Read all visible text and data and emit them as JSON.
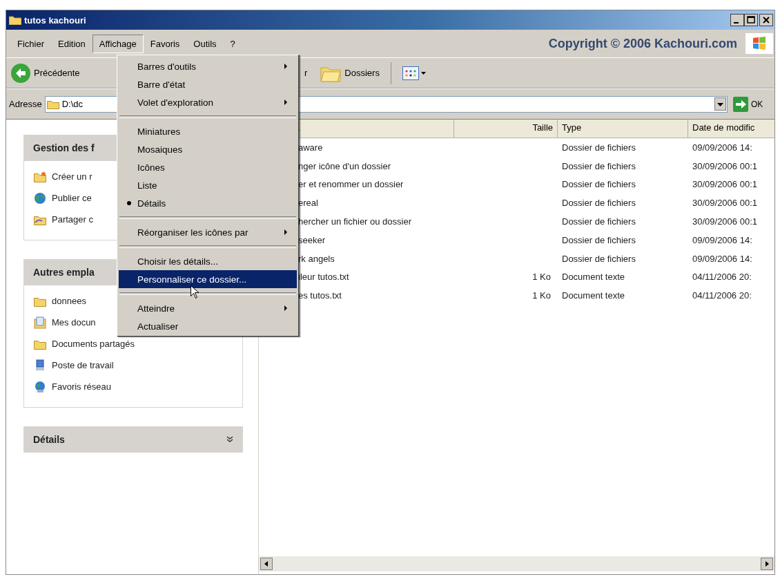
{
  "window": {
    "title": "tutos kachouri"
  },
  "menu_bar": {
    "items": [
      {
        "label": "Fichier",
        "selected": false
      },
      {
        "label": "Edition",
        "selected": false
      },
      {
        "label": "Affichage",
        "selected": true
      },
      {
        "label": "Favoris",
        "selected": false
      },
      {
        "label": "Outils",
        "selected": false
      },
      {
        "label": "?",
        "selected": false
      }
    ],
    "banner": "Copyright © 2006 Kachouri.com"
  },
  "toolbar": {
    "back": "Précédente",
    "search_partial": "r",
    "folders": "Dossiers"
  },
  "address_bar": {
    "label": "Adresse",
    "value": "D:\\dc",
    "go": "OK"
  },
  "sidebar": {
    "panels": [
      {
        "title": "Gestion des f",
        "items": [
          {
            "label": "Créer un r",
            "kind": "new-folder"
          },
          {
            "label": "Publier ce",
            "kind": "globe"
          },
          {
            "label": "Partager c",
            "kind": "share"
          }
        ]
      },
      {
        "title": "Autres empla",
        "items": [
          {
            "label": "donnees",
            "kind": "folder"
          },
          {
            "label": "Mes docun",
            "kind": "documents"
          },
          {
            "label": "Documents partagés",
            "kind": "folder"
          },
          {
            "label": "Poste de travail",
            "kind": "computer"
          },
          {
            "label": "Favoris réseau",
            "kind": "network"
          }
        ]
      },
      {
        "title": "Détails"
      }
    ]
  },
  "file_list": {
    "columns": [
      "Taille",
      "Type",
      "Date de modific"
    ],
    "rows": [
      {
        "name": "aware",
        "size": "",
        "type": "Dossier de fichiers",
        "date": "09/09/2006 14:"
      },
      {
        "name": "nger icône d'un dossier",
        "size": "",
        "type": "Dossier de fichiers",
        "date": "30/09/2006 00:1"
      },
      {
        "name": "er et renommer un dossier",
        "size": "",
        "type": "Dossier de fichiers",
        "date": "30/09/2006 00:1"
      },
      {
        "name": "ereal",
        "size": "",
        "type": "Dossier de fichiers",
        "date": "30/09/2006 00:1"
      },
      {
        "name": "hercher un fichier ou dossier",
        "size": "",
        "type": "Dossier de fichiers",
        "date": "30/09/2006 00:1"
      },
      {
        "name": "seeker",
        "size": "",
        "type": "Dossier de fichiers",
        "date": "09/09/2006 14:"
      },
      {
        "name": "rk angels",
        "size": "",
        "type": "Dossier de fichiers",
        "date": "09/09/2006 14:"
      },
      {
        "name": "ileur tutos.txt",
        "size": "1 Ko",
        "type": "Document texte",
        "date": "04/11/2006 20:"
      },
      {
        "name": "es tutos.txt",
        "size": "1 Ko",
        "type": "Document texte",
        "date": "04/11/2006 20:"
      }
    ]
  },
  "view_menu": {
    "items": [
      {
        "kind": "item",
        "label": "Barres d'outils",
        "submenu": true,
        "bullet": false,
        "selected": false
      },
      {
        "kind": "item",
        "label": "Barre d'état",
        "submenu": false,
        "bullet": false,
        "selected": false
      },
      {
        "kind": "item",
        "label": "Volet d'exploration",
        "submenu": true,
        "bullet": false,
        "selected": false
      },
      {
        "kind": "separator"
      },
      {
        "kind": "item",
        "label": "Miniatures",
        "submenu": false,
        "bullet": false,
        "selected": false
      },
      {
        "kind": "item",
        "label": "Mosaiques",
        "submenu": false,
        "bullet": false,
        "selected": false
      },
      {
        "kind": "item",
        "label": "Icônes",
        "submenu": false,
        "bullet": false,
        "selected": false
      },
      {
        "kind": "item",
        "label": "Liste",
        "submenu": false,
        "bullet": false,
        "selected": false
      },
      {
        "kind": "item",
        "label": "Détails",
        "submenu": false,
        "bullet": true,
        "selected": false
      },
      {
        "kind": "separator"
      },
      {
        "kind": "item",
        "label": "Réorganiser les icônes par",
        "submenu": true,
        "bullet": false,
        "selected": false
      },
      {
        "kind": "separator"
      },
      {
        "kind": "item",
        "label": "Choisir les détails...",
        "submenu": false,
        "bullet": false,
        "selected": false
      },
      {
        "kind": "item",
        "label": "Personnaliser ce dossier...",
        "submenu": false,
        "bullet": false,
        "selected": true
      },
      {
        "kind": "separator"
      },
      {
        "kind": "item",
        "label": "Atteindre",
        "submenu": true,
        "bullet": false,
        "selected": false
      },
      {
        "kind": "item",
        "label": "Actualiser",
        "submenu": false,
        "bullet": false,
        "selected": false
      }
    ]
  }
}
